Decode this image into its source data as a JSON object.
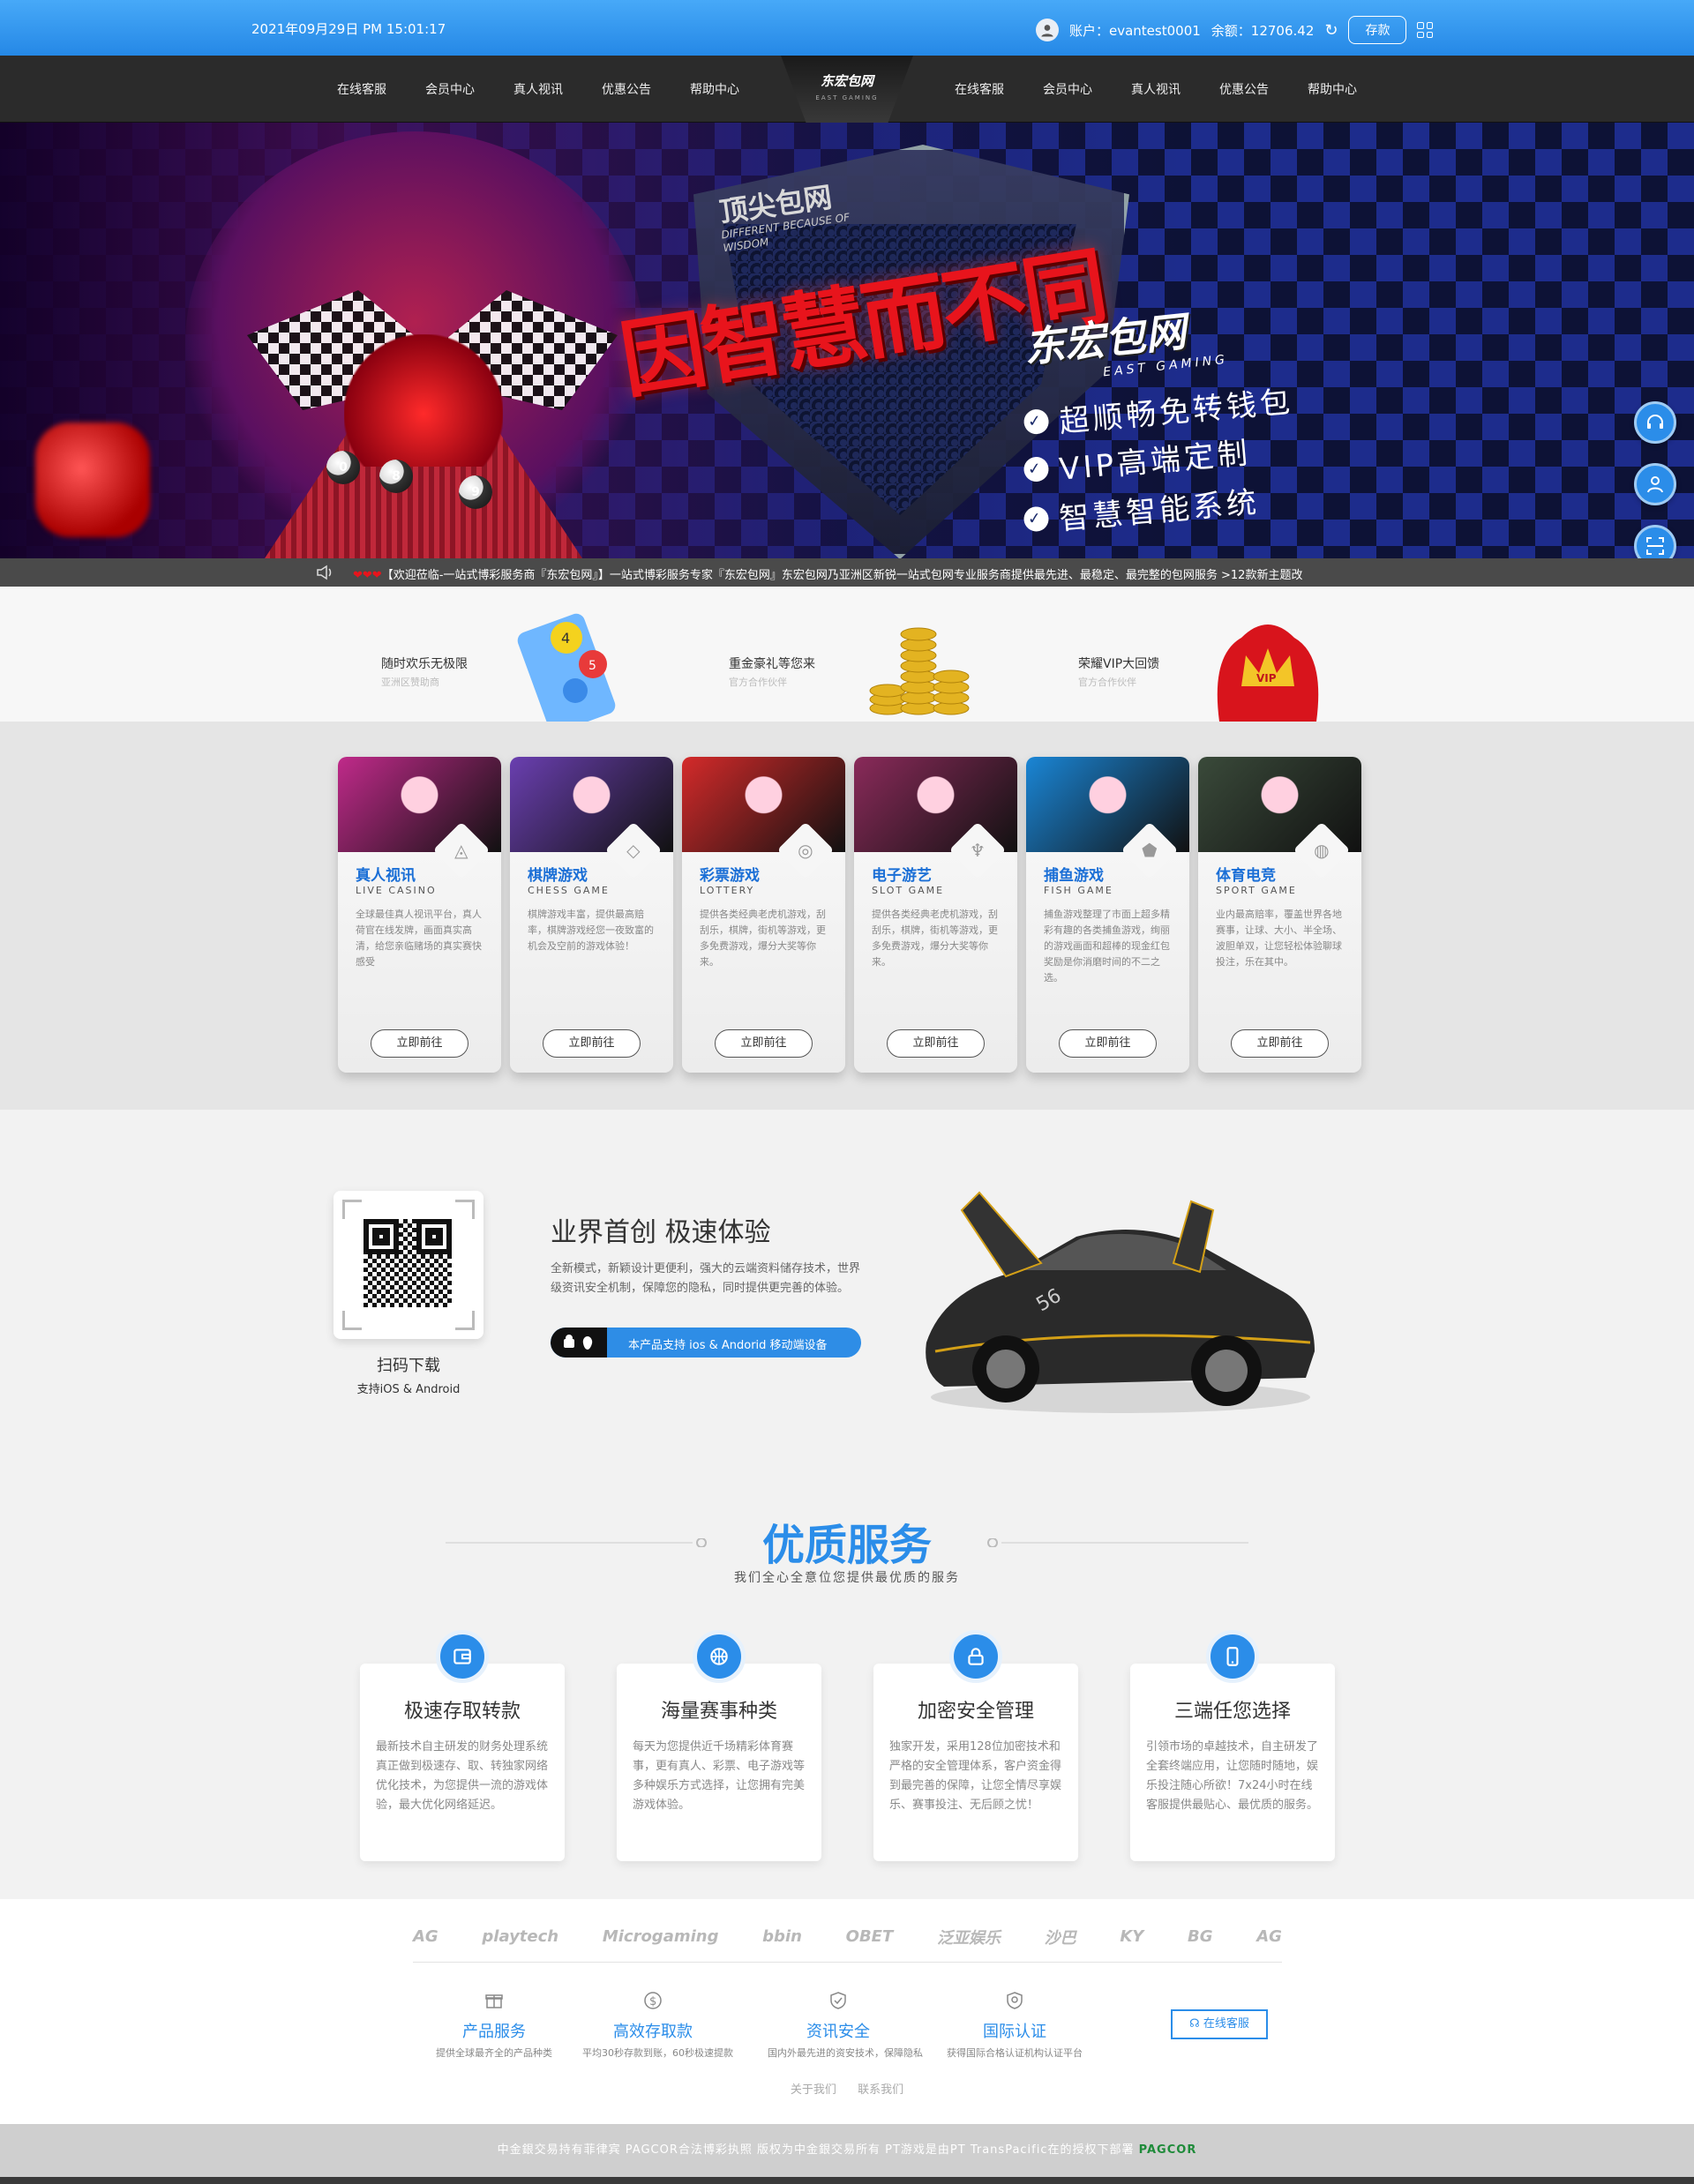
{
  "topbar": {
    "datetime": "2021年09月29日 PM 15:01:17",
    "account": "账户：evantest0001",
    "balance": "余额：12706.42",
    "deposit": "存款"
  },
  "nav": {
    "left": [
      "在线客服",
      "会员中心",
      "真人视讯",
      "优惠公告",
      "帮助中心"
    ],
    "right": [
      "在线客服",
      "会员中心",
      "真人视讯",
      "优惠公告",
      "帮助中心"
    ],
    "logo": "东宏包网",
    "logo_sub": "EAST GAMING"
  },
  "banner": {
    "tag": "顶尖包网",
    "tag_en": "DIFFERENT BECAUSE OF WISDOM",
    "slogan": "因智慧而不同",
    "brand": "东宏包网",
    "brand_sub": "EAST GAMING",
    "features": [
      "超顺畅免转钱包",
      "VIP高端定制",
      "智慧智能系统"
    ]
  },
  "marquee": {
    "hearts": "❤❤❤",
    "text": "【欢迎莅临-一站式博彩服务商『东宏包网』】一站式博彩服务专家『东宏包网』东宏包网乃亚洲区新锐一站式包网专业服务商提供最先进、最稳定、最完整的包网服务 >12款新主题改"
  },
  "promo": [
    {
      "title": "随时欢乐无极限",
      "sub": "亚洲区赞助商"
    },
    {
      "title": "重金豪礼等您来",
      "sub": "官方合作伙伴"
    },
    {
      "title": "荣耀VIP大回馈",
      "sub": "官方合作伙伴"
    }
  ],
  "games": [
    {
      "name": "真人视讯",
      "en": "LIVE CASINO",
      "desc": "全球最佳真人视讯平台，真人荷官在线发牌，画面真实高清，给您亲临赌场的真实赛快感受",
      "btn": "立即前往",
      "icon": "fox-icon",
      "color": "#c02a8a"
    },
    {
      "name": "棋牌游戏",
      "en": "CHESS GAME",
      "desc": "棋牌游戏丰富，提供最高赔率，棋牌游戏经您一夜致富的机会及空前的游戏体验！",
      "btn": "立即前往",
      "icon": "diamond-icon",
      "color": "#6a3fb0"
    },
    {
      "name": "彩票游戏",
      "en": "LOTTERY",
      "desc": "提供各类经典老虎机游戏，刮刮乐，棋牌，街机等游戏，更多免费游戏，爆分大奖等你来。",
      "btn": "立即前往",
      "icon": "chrome-icon",
      "color": "#d42a2a"
    },
    {
      "name": "电子游艺",
      "en": "SLOT GAME",
      "desc": "提供各类经典老虎机游戏，刮刮乐，棋牌，街机等游戏，更多免费游戏，爆分大奖等你来。",
      "btn": "立即前往",
      "icon": "rocket-icon",
      "color": "#8a2a5a"
    },
    {
      "name": "捕鱼游戏",
      "en": "FISH GAME",
      "desc": "捕鱼游戏整理了市面上超多精彩有趣的各类捕鱼游戏，绚丽的游戏画面和超棒的现金红包奖励是你消磨时间的不二之选。",
      "btn": "立即前往",
      "icon": "pentagon-icon",
      "color": "#1a86d6"
    },
    {
      "name": "体育电竞",
      "en": "SPORT GAME",
      "desc": "业内最高赔率，覆盖世界各地赛事，让球、大小、半全场、波胆单双，让您轻松体验聊球投注，乐在其中。",
      "btn": "立即前往",
      "icon": "basketball-icon",
      "color": "#3a4a3a"
    }
  ],
  "app": {
    "scan": "扫码下载",
    "scan_sub": "支持iOS & Android",
    "title": "业界首创 极速体验",
    "desc": "全新模式，新颖设计更便利，强大的云端资料储存技术，世界级资讯安全机制，保障您的隐私，同时提供更完善的体验。",
    "os_icons": "🤖",
    "support": "本产品支持 ios & Andorid 移动端设备"
  },
  "service": {
    "title": "优质服务",
    "subtitle": "我们全心全意位您提供最优质的服务",
    "items": [
      {
        "title": "极速存取转款",
        "desc": "最新技术自主研发的财务处理系统真正做到极速存、取、转独家网络优化技术，为您提供一流的游戏体验，最大优化网络延迟。",
        "icon": "wallet-icon"
      },
      {
        "title": "海量赛事种类",
        "desc": "每天为您提供近千场精彩体育赛事，更有真人、彩票、电子游戏等多种娱乐方式选择，让您拥有完美游戏体验。",
        "icon": "basketball-icon"
      },
      {
        "title": "加密安全管理",
        "desc": "独家开发，采用128位加密技术和严格的安全管理体系，客户资金得到最完善的保障，让您全情尽享娱乐、赛事投注、无后顾之忧！",
        "icon": "lock-icon"
      },
      {
        "title": "三端任您选择",
        "desc": "引领市场的卓越技术，自主研发了全套终端应用，让您随时随地，娱乐投注随心所欲！7x24小时在线客服提供最贴心、最优质的服务。",
        "icon": "mobile-icon"
      }
    ]
  },
  "partners": [
    "AG",
    "playtech",
    "Microgaming",
    "bbin",
    "OBET",
    "泛亚娱乐",
    "沙巴",
    "KY",
    "BG",
    "AG"
  ],
  "footer_feats": [
    {
      "title": "产品服务",
      "desc": "提供全球最齐全的产品种类",
      "icon": "gift-icon"
    },
    {
      "title": "高效存取款",
      "desc": "平均30秒存款到账，60秒极速提款",
      "icon": "dollar-icon"
    },
    {
      "title": "资讯安全",
      "desc": "国内外最先进的资安技术，保障隐私",
      "icon": "shield-check-icon"
    },
    {
      "title": "国际认证",
      "desc": "获得国际合格认证机构认证平台",
      "icon": "certificate-icon"
    }
  ],
  "kefu": "在线客服",
  "links": [
    "关于我们",
    "联系我们"
  ],
  "copyright": "中金銀交易持有菲律宾 PAGCOR合法博彩执照 版权为中金銀交易所有 PT游戏是由PT TransPacific在的授权下部署",
  "pagcor": "PAGCOR",
  "colors": {
    "accent": "#2b8de9",
    "nav_bg": "#2b2b2b",
    "slogan": "#e8141c"
  }
}
